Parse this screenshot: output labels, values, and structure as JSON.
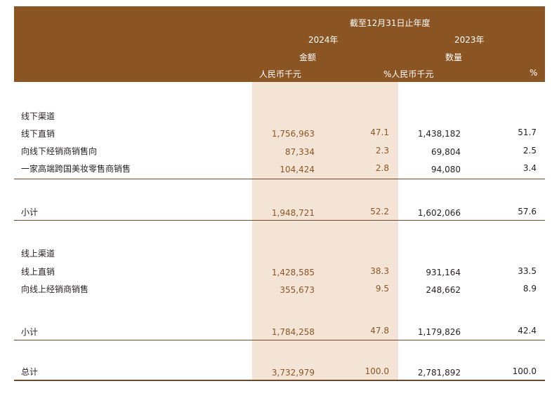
{
  "header": {
    "period": "截至12月31日止年度",
    "year_2024": "2024年",
    "year_2023": "2023年",
    "amount": "金额",
    "quantity": "数量",
    "unit_rmb": "人民币千元",
    "unit_pct_rmb": "%人民币千元",
    "unit_pct": "%"
  },
  "rows": [
    {
      "label": "线下渠道",
      "a": "",
      "b": "",
      "c": "",
      "d": ""
    },
    {
      "label": "线下直销",
      "a": "1,756,963",
      "b": "47.1",
      "c": "1,438,182",
      "d": "51.7"
    },
    {
      "label": "向线下经销商销售向",
      "a": "87,334",
      "b": "2.3",
      "c": "69,804",
      "d": "2.5"
    },
    {
      "label": "一家高端跨国美妆零售商销售",
      "a": "104,424",
      "b": "2.8",
      "c": "94,080",
      "d": "3.4"
    },
    {
      "label": "小计",
      "a": "1,948,721",
      "b": "52.2",
      "c": "1,602,066",
      "d": "57.6"
    },
    {
      "label": "线上渠道",
      "a": "",
      "b": "",
      "c": "",
      "d": ""
    },
    {
      "label": "线上直销",
      "a": "1,428,585",
      "b": "38.3",
      "c": "931,164",
      "d": "33.5"
    },
    {
      "label": "向线上经销商销售",
      "a": "355,673",
      "b": "9.5",
      "c": "248,662",
      "d": "8.9"
    },
    {
      "label": "小计",
      "a": "1,784,258",
      "b": "47.8",
      "c": "1,179,826",
      "d": "42.4"
    },
    {
      "label": "总计",
      "a": "3,732,979",
      "b": "100.0",
      "c": "2,781,892",
      "d": "100.0"
    }
  ]
}
